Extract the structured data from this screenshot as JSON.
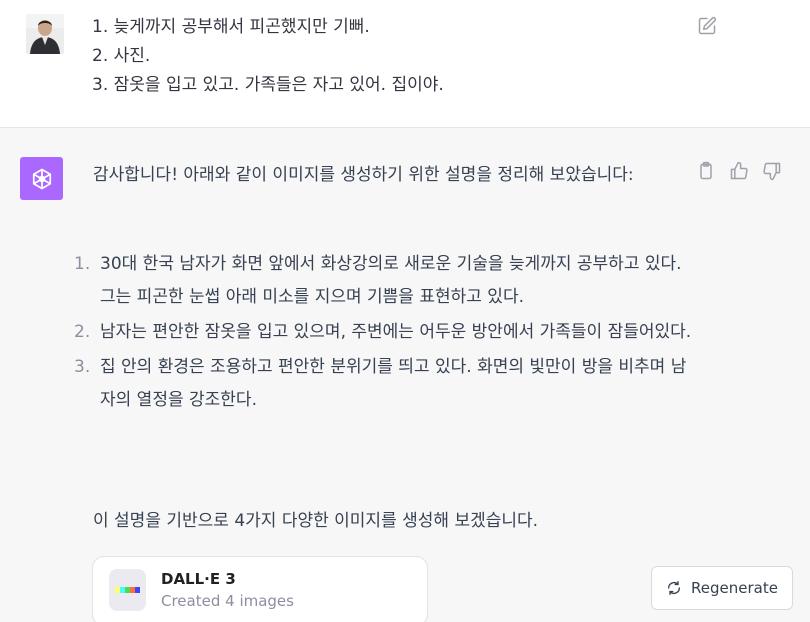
{
  "user_message": {
    "lines": [
      "1. 늦게까지 공부해서 피곤했지만 기뻐.",
      "2. 사진.",
      "3. 잠옷을 입고 있고. 가족들은 자고 있어. 집이야."
    ],
    "edit_icon": "pencil-square-icon"
  },
  "assistant_message": {
    "avatar_icon": "openai-logo-icon",
    "intro": "감사합니다! 아래와 같이 이미지를 생성하기 위한 설명을 정리해 보았습니다:",
    "steps": [
      {
        "num": "1.",
        "text": "30대 한국 남자가 화면 앞에서 화상강의로 새로운 기술을 늦게까지 공부하고 있다. 그는 피곤한 눈썹 아래 미소를 지으며 기쁨을 표현하고 있다."
      },
      {
        "num": "2.",
        "text": "남자는 편안한 잠옷을 입고 있으며, 주변에는 어두운 방안에서 가족들이 잠들어있다."
      },
      {
        "num": "3.",
        "text": "집 안의 환경은 조용하고 편안한 분위기를 띄고 있다. 화면의 빛만이 방을 비추며 남자의 열정을 강조한다."
      }
    ],
    "outro": "이 설명을 기반으로 4가지 다양한 이미지를 생성해 보겠습니다.",
    "actions": [
      "copy-icon",
      "thumbs-up-icon",
      "thumbs-down-icon"
    ]
  },
  "dalle_card": {
    "name": "DALL·E 3",
    "subtitle": "Created 4 images"
  },
  "regenerate": {
    "label": "Regenerate",
    "icon": "refresh-icon"
  },
  "colors": {
    "gpt_avatar_bg": "#ab68ff",
    "assistant_bg": "#f7f7f8",
    "muted_text": "#8e8ea0"
  }
}
